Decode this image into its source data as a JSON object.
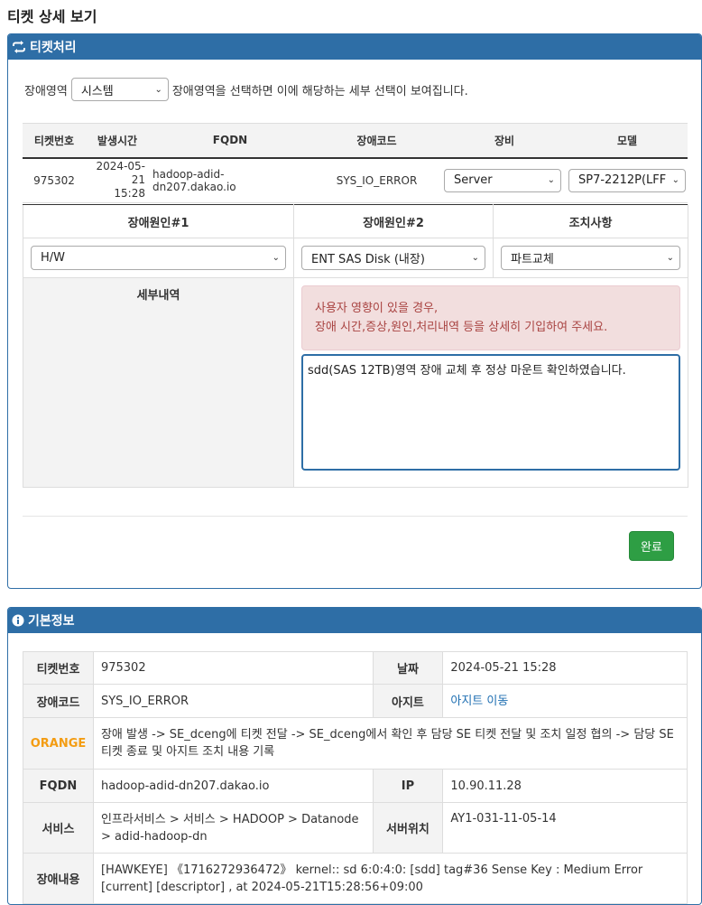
{
  "page": {
    "title": "티켓 상세 보기"
  },
  "process_panel": {
    "title": "티켓처리",
    "area_label": "장애영역",
    "area_value": "시스템",
    "area_hint": "장애영역을 선택하면 이에 해당하는 세부 선택이 보여집니다.",
    "ticket_table": {
      "headers": {
        "ticket_no": "티켓번호",
        "time": "발생시간",
        "fqdn": "FQDN",
        "code": "장애코드",
        "equipment": "장비",
        "model": "모델"
      },
      "row": {
        "ticket_no": "975302",
        "date": "2024-05-21",
        "time": "15:28",
        "fqdn": "hadoop-adid-dn207.dakao.io",
        "code": "SYS_IO_ERROR",
        "equipment": "Server",
        "model": "SP7-2212P(LFF"
      }
    },
    "cause_table": {
      "headers": {
        "cause1": "장애원인#1",
        "cause2": "장애원인#2",
        "action": "조치사항"
      },
      "cause1_value": "H/W",
      "cause2_value": "ENT SAS Disk (내장)",
      "action_value": "파트교체",
      "detail_label": "세부내역",
      "alert_line1": "사용자 영향이 있을 경우,",
      "alert_line2": "장애 시간,증상,원인,처리내역 등을 상세히 기입하여 주세요.",
      "detail_text": "sdd(SAS 12TB)영역 장애 교체 후 정상 마운트 확인하였습니다."
    },
    "done_button": "완료"
  },
  "basic_panel": {
    "title": "기본정보",
    "rows": {
      "ticket_label": "티켓번호",
      "ticket_value": "975302",
      "date_label": "날짜",
      "date_value": "2024-05-21 15:28",
      "code_label": "장애코드",
      "code_value": "SYS_IO_ERROR",
      "agit_label": "아지트",
      "agit_link": "아지트 이동",
      "orange_label": "ORANGE",
      "orange_value": "장애 발생 -> SE_dceng에 티켓 전달 -> SE_dceng에서 확인 후 담당 SE 티켓 전달 및 조치 일정 협의 -> 담당 SE 티켓 종료 및 아지트 조치 내용 기록",
      "fqdn_label": "FQDN",
      "fqdn_value": "hadoop-adid-dn207.dakao.io",
      "ip_label": "IP",
      "ip_value": "10.90.11.28",
      "service_label": "서비스",
      "service_value": "인프라서비스 > 서비스 > HADOOP > Datanode > adid-hadoop-dn",
      "location_label": "서버위치",
      "location_value": "AY1-031-11-05-14",
      "content_label": "장애내용",
      "content_value": "[HAWKEYE] 《1716272936472》 kernel::  sd 6:0:4:0: [sdd] tag#36 Sense Key : Medium Error [current] [descriptor] , at 2024-05-21T15:28:56+09:00"
    }
  },
  "colors": {
    "panel_header": "#2e6ea6",
    "done_button": "#2e9e44",
    "orange": "#f39c12",
    "alert_bg": "#f2dede",
    "alert_text": "#a94442"
  }
}
